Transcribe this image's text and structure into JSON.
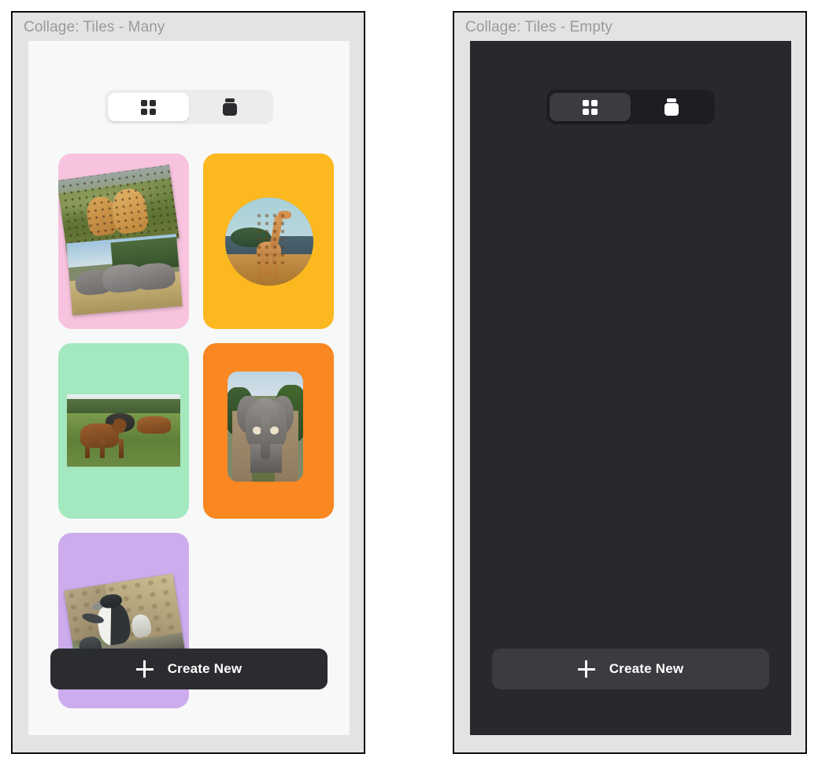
{
  "panels": [
    {
      "title": "Collage: Tiles - Many",
      "theme": "light",
      "segmented": {
        "options": [
          {
            "id": "grid",
            "icon": "grid-icon",
            "selected": true
          },
          {
            "id": "trash",
            "icon": "trash-bin-icon",
            "selected": false
          }
        ]
      },
      "create_button": {
        "label": "Create New",
        "icon": "plus-icon"
      },
      "tiles": [
        {
          "id": "tile-1",
          "background": "#f7c3de",
          "photos": [
            {
              "id": "photo-cheetahs",
              "subject": "cheetahs",
              "shape": "rect",
              "rotation": -8
            },
            {
              "id": "photo-rhinos",
              "subject": "rhinos",
              "shape": "rect",
              "rotation": -5
            }
          ]
        },
        {
          "id": "tile-2",
          "background": "#fcb81f",
          "photos": [
            {
              "id": "photo-giraffe",
              "subject": "giraffe",
              "shape": "circle",
              "rotation": 0
            }
          ]
        },
        {
          "id": "tile-3",
          "background": "#a4e8c0",
          "photos": [
            {
              "id": "photo-nyala",
              "subject": "nyala antelope",
              "shape": "rect",
              "rotation": 0
            }
          ]
        },
        {
          "id": "tile-4",
          "background": "#f98722",
          "photos": [
            {
              "id": "photo-elephant",
              "subject": "elephant",
              "shape": "rounded",
              "rotation": 0
            }
          ]
        },
        {
          "id": "tile-5",
          "background": "#cdaced",
          "photos": [
            {
              "id": "photo-penguins",
              "subject": "penguins",
              "shape": "rect",
              "rotation": -9
            }
          ]
        }
      ]
    },
    {
      "title": "Collage: Tiles - Empty",
      "theme": "dark",
      "segmented": {
        "options": [
          {
            "id": "grid",
            "icon": "grid-icon",
            "selected": true
          },
          {
            "id": "trash",
            "icon": "trash-bin-icon",
            "selected": false
          }
        ]
      },
      "create_button": {
        "label": "Create New",
        "icon": "plus-icon"
      },
      "tiles": []
    }
  ],
  "colors": {
    "frame_border": "#0d0d0d",
    "frame_fill": "#e3e3e3",
    "title_text": "#9a9a9a",
    "light_viewport": "#f7f8f8",
    "dark_viewport": "#27292d",
    "light_segment_track": "#ececec",
    "dark_segment_track": "#1d1e21",
    "light_segment_active": "#ffffff",
    "dark_segment_active": "#3a3c40",
    "light_button": "#2b2c30",
    "dark_button": "#3a3c40",
    "button_text": "#ffffff"
  }
}
